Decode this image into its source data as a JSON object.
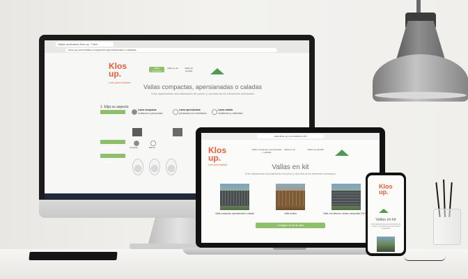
{
  "monitor": {
    "tab_title": "Vallas modulares Klos up · Fácil",
    "url": "klos-up.com/vallas-compactas-apersianadas-o-caladas",
    "logo_line1": "Klos",
    "logo_line2": "up.",
    "tagline": "Lote para Instalar",
    "nav": [
      "Vallas compactas, apersianadas o caladas",
      "Vallas en kit",
      "Vallas de pantalla"
    ],
    "heading": "Vallas compactas, apersianadas o caladas",
    "subheading": "Crea rápidamente una estimación de precio y una lista de los elementos necesarios",
    "step_title": "1. Elija su aspecto",
    "options": [
      {
        "title": "Lama compacta",
        "desc": "ocultación y privacidad"
      },
      {
        "title": "Lama apersianada",
        "desc": "privacidad con ventilación"
      },
      {
        "title": "Lama calada",
        "desc": "ventilación y visibilidad"
      }
    ],
    "side_labels": [
      "Elija el color",
      "Tipo de poste",
      "Altura"
    ],
    "color_labels": [
      "Antracita",
      "Blanco"
    ]
  },
  "laptop": {
    "url": "www.klos-up.com/vallas-en-kit",
    "logo_line1": "Klos",
    "logo_line2": "up.",
    "tagline": "Lote para Instalar",
    "nav": [
      "Vallas compactas, apersianadas o caladas",
      "Vallas en kit",
      "Vallas de pantalla"
    ],
    "heading": "Vallas en kit",
    "subheading": "Cree rápidamente una estimación de precio y una lista de los elementos necesarios",
    "products": [
      "Valla compacta, apersianada o calada",
      "Valla rústica",
      "Valla con listones, lamas compactas 100 mm"
    ],
    "button": "Configure su kit de valla"
  },
  "phone": {
    "logo_line1": "Klos",
    "logo_line2": "up.",
    "heading": "Vallas en kit",
    "subheading": "Cree rápidamente una estimación de precio y una lista de los elementos necesarios"
  },
  "colors": {
    "brand_orange": "#e85d38",
    "brand_green": "#8fbf6a",
    "logo_green": "#4e9a52"
  }
}
